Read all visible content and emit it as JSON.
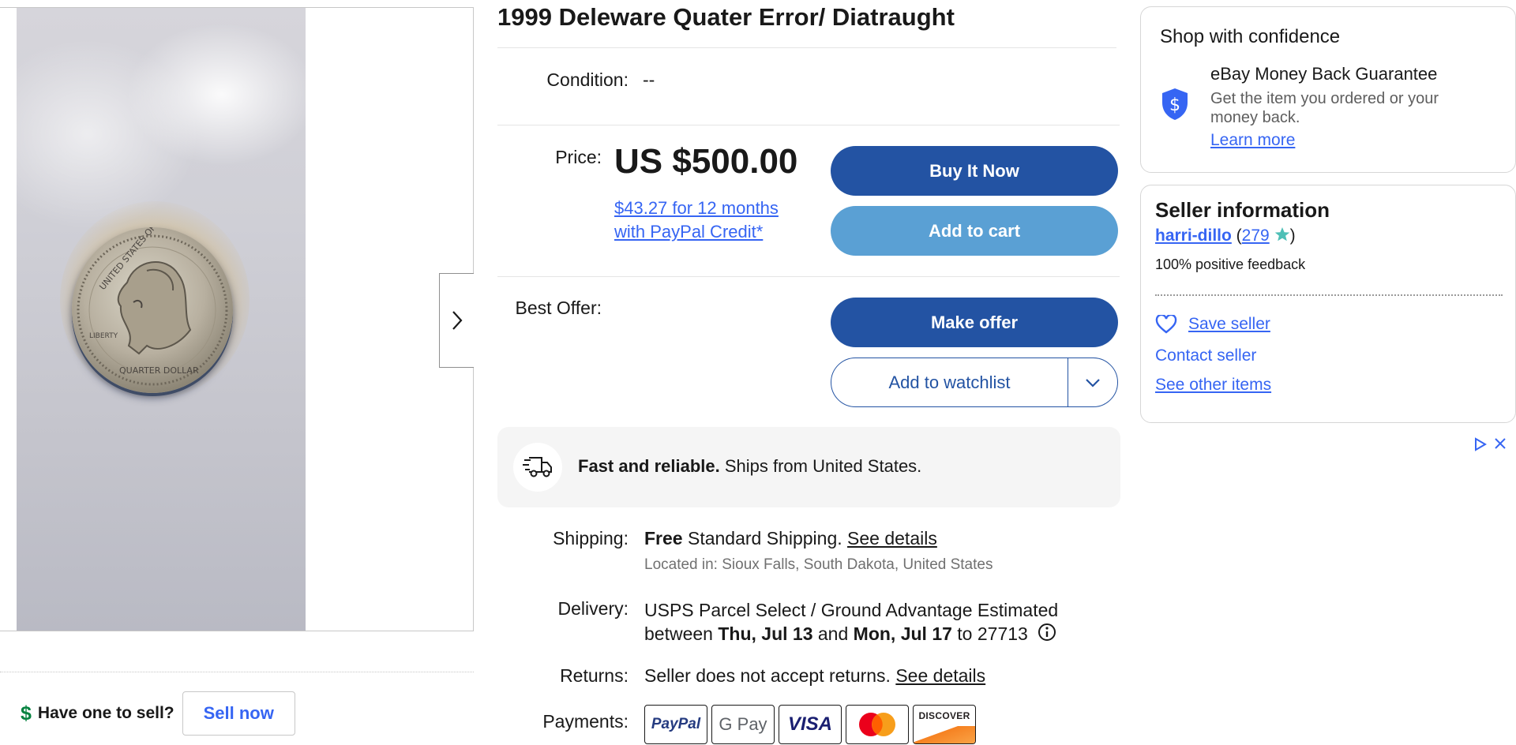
{
  "listing": {
    "title": "1999 Deleware Quater Error/ Diatraught",
    "condition_label": "Condition:",
    "condition_value": "--",
    "price_label": "Price:",
    "price": "US $500.00",
    "credit_line1": "$43.27 for 12 months",
    "credit_line2": "with PayPal Credit*",
    "best_offer_label": "Best Offer:"
  },
  "actions": {
    "buy_now": "Buy It Now",
    "add_to_cart": "Add to cart",
    "make_offer": "Make offer",
    "watchlist": "Add to watchlist"
  },
  "shipping_banner": {
    "bold": "Fast and reliable.",
    "text": " Ships from United States."
  },
  "details": {
    "shipping_label": "Shipping:",
    "shipping_free": "Free",
    "shipping_text": " Standard Shipping. ",
    "shipping_link": "See details",
    "location": "Located in: Sioux Falls, South Dakota, United States",
    "delivery_label": "Delivery:",
    "delivery_line1": "USPS Parcel Select / Ground Advantage Estimated",
    "delivery_between": "between ",
    "delivery_date1": "Thu, Jul 13",
    "delivery_and": " and ",
    "delivery_date2": "Mon, Jul 17",
    "delivery_to": " to 27713",
    "returns_label": "Returns:",
    "returns_text": "Seller does not accept returns. ",
    "returns_link": "See details",
    "payments_label": "Payments:",
    "payment_methods": [
      "PayPal",
      "G Pay",
      "VISA",
      "Mastercard",
      "DISCOVER"
    ]
  },
  "confidence": {
    "heading": "Shop with confidence",
    "guarantee_title": "eBay Money Back Guarantee",
    "guarantee_text_1": "Get the item you ordered or your",
    "guarantee_text_2": "money back.",
    "learn_more": "Learn more"
  },
  "seller": {
    "heading": "Seller information",
    "name": "harri-dillo",
    "open_paren": " (",
    "score": "279",
    "close_paren": ")",
    "feedback": "100% positive feedback",
    "save": "Save seller",
    "contact": "Contact seller",
    "other_items": "See other items"
  },
  "sell": {
    "prompt": "Have one to sell?",
    "button": "Sell now",
    "icon": "$"
  },
  "colors": {
    "primary_button": "#2353a3",
    "secondary_button": "#5aa0d4",
    "link": "#3665f3",
    "sell_icon": "#05823f"
  }
}
